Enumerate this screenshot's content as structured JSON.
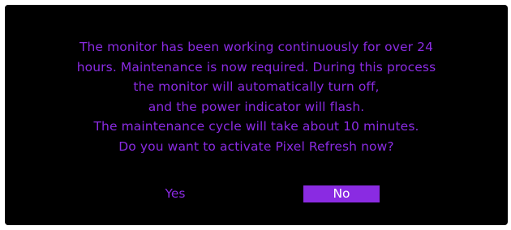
{
  "dialog": {
    "message_lines": [
      "The monitor has been working continuously for over 24",
      "hours. Maintenance is now required. During this process",
      "the monitor will automatically turn off,",
      "and the power indicator will flash.",
      "The maintenance cycle will take about 10 minutes.",
      "Do you want to activate Pixel Refresh now?"
    ],
    "yes_label": "Yes",
    "no_label": "No",
    "selected_option": "No"
  },
  "colors": {
    "background": "#000000",
    "text": "#8a2be2",
    "highlight": "#8a2be2",
    "highlight_text": "#ffffff"
  }
}
